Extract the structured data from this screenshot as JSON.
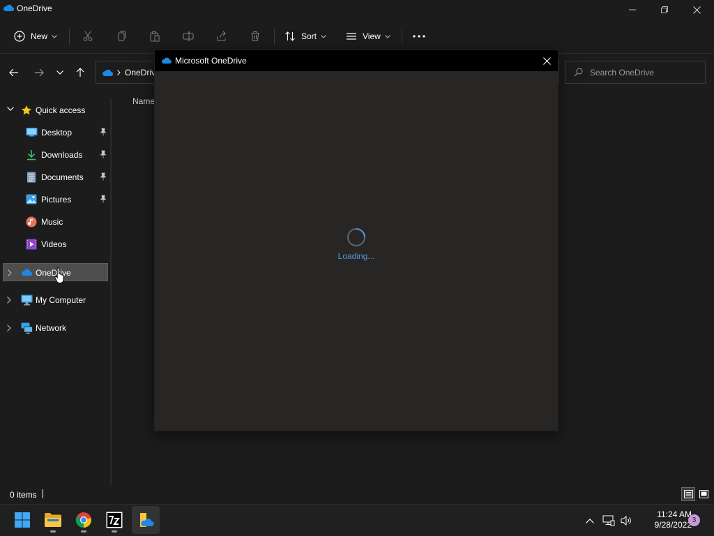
{
  "window": {
    "title": "OneDrive"
  },
  "toolbar": {
    "new_label": "New",
    "sort_label": "Sort",
    "view_label": "View"
  },
  "address": {
    "crumb": "OneDrive",
    "search_placeholder": "Search OneDrive"
  },
  "sidebar": {
    "quick_access": "Quick access",
    "items": [
      {
        "label": "Desktop",
        "icon": "desktop-icon",
        "pinned": true
      },
      {
        "label": "Downloads",
        "icon": "downloads-icon",
        "pinned": true
      },
      {
        "label": "Documents",
        "icon": "documents-icon",
        "pinned": true
      },
      {
        "label": "Pictures",
        "icon": "pictures-icon",
        "pinned": true
      },
      {
        "label": "Music",
        "icon": "music-icon",
        "pinned": false
      },
      {
        "label": "Videos",
        "icon": "videos-icon",
        "pinned": false
      }
    ],
    "onedrive": "OneDrive",
    "my_computer": "My Computer",
    "network": "Network"
  },
  "content": {
    "column_name": "Name"
  },
  "status": {
    "item_count": "0 items"
  },
  "dialog": {
    "title": "Microsoft OneDrive",
    "loading_text": "Loading..."
  },
  "taskbar": {
    "time": "11:24 AM",
    "date": "9/28/2022",
    "notification_count": "3"
  },
  "colors": {
    "accent": "#4f94d6",
    "onedrive_blue": "#1e88e5",
    "selected_bg": "#4d4d4d",
    "dialog_bg": "#282624"
  }
}
